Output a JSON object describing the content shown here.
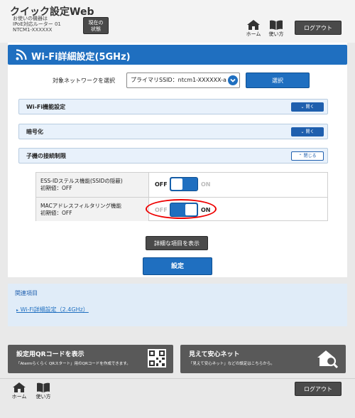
{
  "header": {
    "app_title": "クイック設定Web",
    "device_line1": "お使いの機器は",
    "device_line2": "IPoE対応ルーター 01",
    "device_line3": "NTCM1-XXXXXX",
    "status_line1": "現在の",
    "status_line2": "状態",
    "home_label": "ホーム",
    "help_label": "使い方",
    "logout_label": "ログアウト"
  },
  "section": {
    "title": "Wi-Fi詳細設定(5GHz)"
  },
  "network": {
    "label": "対象ネットワークを選択",
    "selected": "プライマリSSID：ntcm1-XXXXXX-a",
    "select_button": "選択"
  },
  "accordions": [
    {
      "title": "Wi-Fi機能設定",
      "button": "開く"
    },
    {
      "title": "暗号化",
      "button": "開く"
    },
    {
      "title": "子機の接続制限",
      "button": "閉じる"
    }
  ],
  "settings": [
    {
      "label_line1": "ESS-IDステルス機能(SSIDの隠蔽)",
      "label_line2": "初期値：OFF",
      "off": "OFF",
      "on": "ON",
      "state": "off"
    },
    {
      "label_line1": "MACアドレスフィルタリング機能",
      "label_line2": "初期値：OFF",
      "off": "OFF",
      "on": "ON",
      "state": "on"
    }
  ],
  "buttons": {
    "detail": "詳細な項目を表示",
    "submit": "設定"
  },
  "related": {
    "title": "関連項目",
    "link": "Wi-Fi詳細設定（2.4GHz）"
  },
  "cards": {
    "qr_title": "設定用QRコードを表示",
    "qr_desc": "「Atermらくらく QRスタート」用のQRコードを作成できます。",
    "safe_title": "見えて安心ネット",
    "safe_desc": "「見えて安心ネット」などの設定はこちらから。"
  },
  "footer": {
    "home_label": "ホーム",
    "help_label": "使い方",
    "logout_label": "ログアウト"
  },
  "colors": {
    "accent": "#1f6fc0",
    "dark_button": "#4a4a4a",
    "highlight": "#ee0000"
  }
}
